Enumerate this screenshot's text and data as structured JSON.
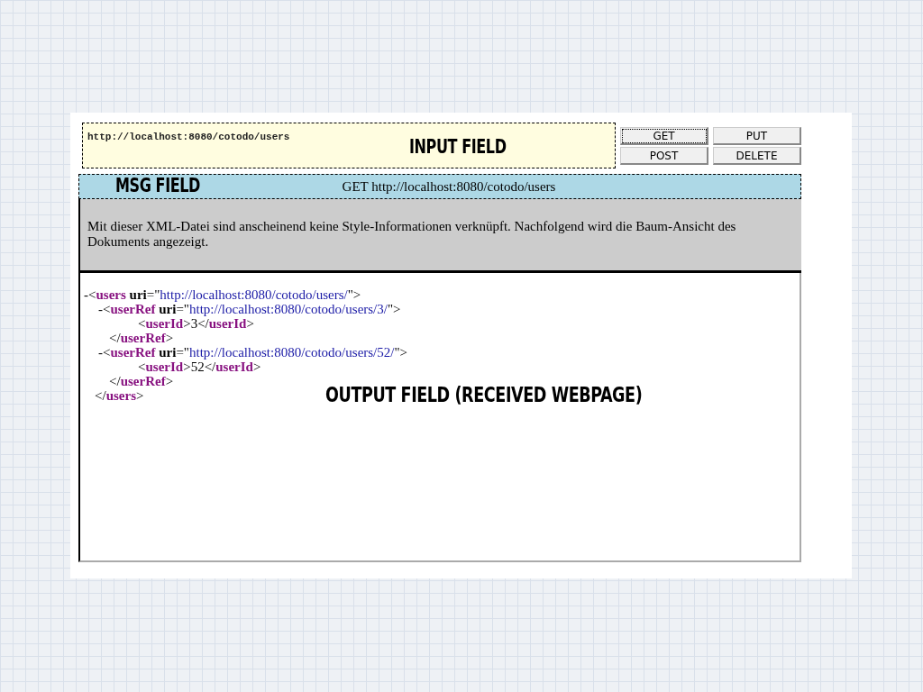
{
  "input_field": {
    "value": "http://localhost:8080/cotodo/users",
    "annotation": "INPUT FIELD"
  },
  "buttons": [
    {
      "label": "GET",
      "focused": true
    },
    {
      "label": "PUT",
      "focused": false
    },
    {
      "label": "POST",
      "focused": false
    },
    {
      "label": "DELETE",
      "focused": false
    }
  ],
  "msg_field": {
    "annotation": "MSG FIELD",
    "text": "GET http://localhost:8080/cotodo/users"
  },
  "info_message": "Mit dieser XML-Datei sind anscheinend keine Style-Informationen verknüpft. Nachfolgend wird die Baum-Ansicht des Dokuments angezeigt.",
  "xml_tree": [
    {
      "toggle": "-",
      "open": [
        {
          "kind": "punct",
          "t": "<"
        },
        {
          "kind": "tag",
          "t": "users"
        },
        {
          "kind": "attr",
          "t": " uri"
        },
        {
          "kind": "punct",
          "t": "=\""
        },
        {
          "kind": "value",
          "t": "http://localhost:8080/cotodo/users/"
        },
        {
          "kind": "punct",
          "t": "\">"
        }
      ],
      "close": [
        {
          "kind": "punct",
          "t": "</"
        },
        {
          "kind": "tag",
          "t": "users"
        },
        {
          "kind": "punct",
          "t": ">"
        }
      ],
      "children": [
        {
          "toggle": "-",
          "open": [
            {
              "kind": "punct",
              "t": "<"
            },
            {
              "kind": "tag",
              "t": "userRef"
            },
            {
              "kind": "attr",
              "t": " uri"
            },
            {
              "kind": "punct",
              "t": "=\""
            },
            {
              "kind": "value",
              "t": "http://localhost:8080/cotodo/users/3/"
            },
            {
              "kind": "punct",
              "t": "\">"
            }
          ],
          "close": [
            {
              "kind": "punct",
              "t": "</"
            },
            {
              "kind": "tag",
              "t": "userRef"
            },
            {
              "kind": "punct",
              "t": ">"
            }
          ],
          "children": [
            {
              "open": [
                {
                  "kind": "punct",
                  "t": "<"
                },
                {
                  "kind": "tag",
                  "t": "userId"
                },
                {
                  "kind": "punct",
                  "t": ">"
                },
                {
                  "kind": "text",
                  "t": "3"
                },
                {
                  "kind": "punct",
                  "t": "</"
                },
                {
                  "kind": "tag",
                  "t": "userId"
                },
                {
                  "kind": "punct",
                  "t": ">"
                }
              ]
            }
          ]
        },
        {
          "toggle": "-",
          "open": [
            {
              "kind": "punct",
              "t": "<"
            },
            {
              "kind": "tag",
              "t": "userRef"
            },
            {
              "kind": "attr",
              "t": " uri"
            },
            {
              "kind": "punct",
              "t": "=\""
            },
            {
              "kind": "value",
              "t": "http://localhost:8080/cotodo/users/52/"
            },
            {
              "kind": "punct",
              "t": "\">"
            }
          ],
          "close": [
            {
              "kind": "punct",
              "t": "</"
            },
            {
              "kind": "tag",
              "t": "userRef"
            },
            {
              "kind": "punct",
              "t": ">"
            }
          ],
          "children": [
            {
              "open": [
                {
                  "kind": "punct",
                  "t": "<"
                },
                {
                  "kind": "tag",
                  "t": "userId"
                },
                {
                  "kind": "punct",
                  "t": ">"
                },
                {
                  "kind": "text",
                  "t": "52"
                },
                {
                  "kind": "punct",
                  "t": "</"
                },
                {
                  "kind": "tag",
                  "t": "userId"
                },
                {
                  "kind": "punct",
                  "t": ">"
                }
              ]
            }
          ]
        }
      ]
    }
  ],
  "output_annotation": "OUTPUT FIELD (RECEIVED WEBPAGE)"
}
